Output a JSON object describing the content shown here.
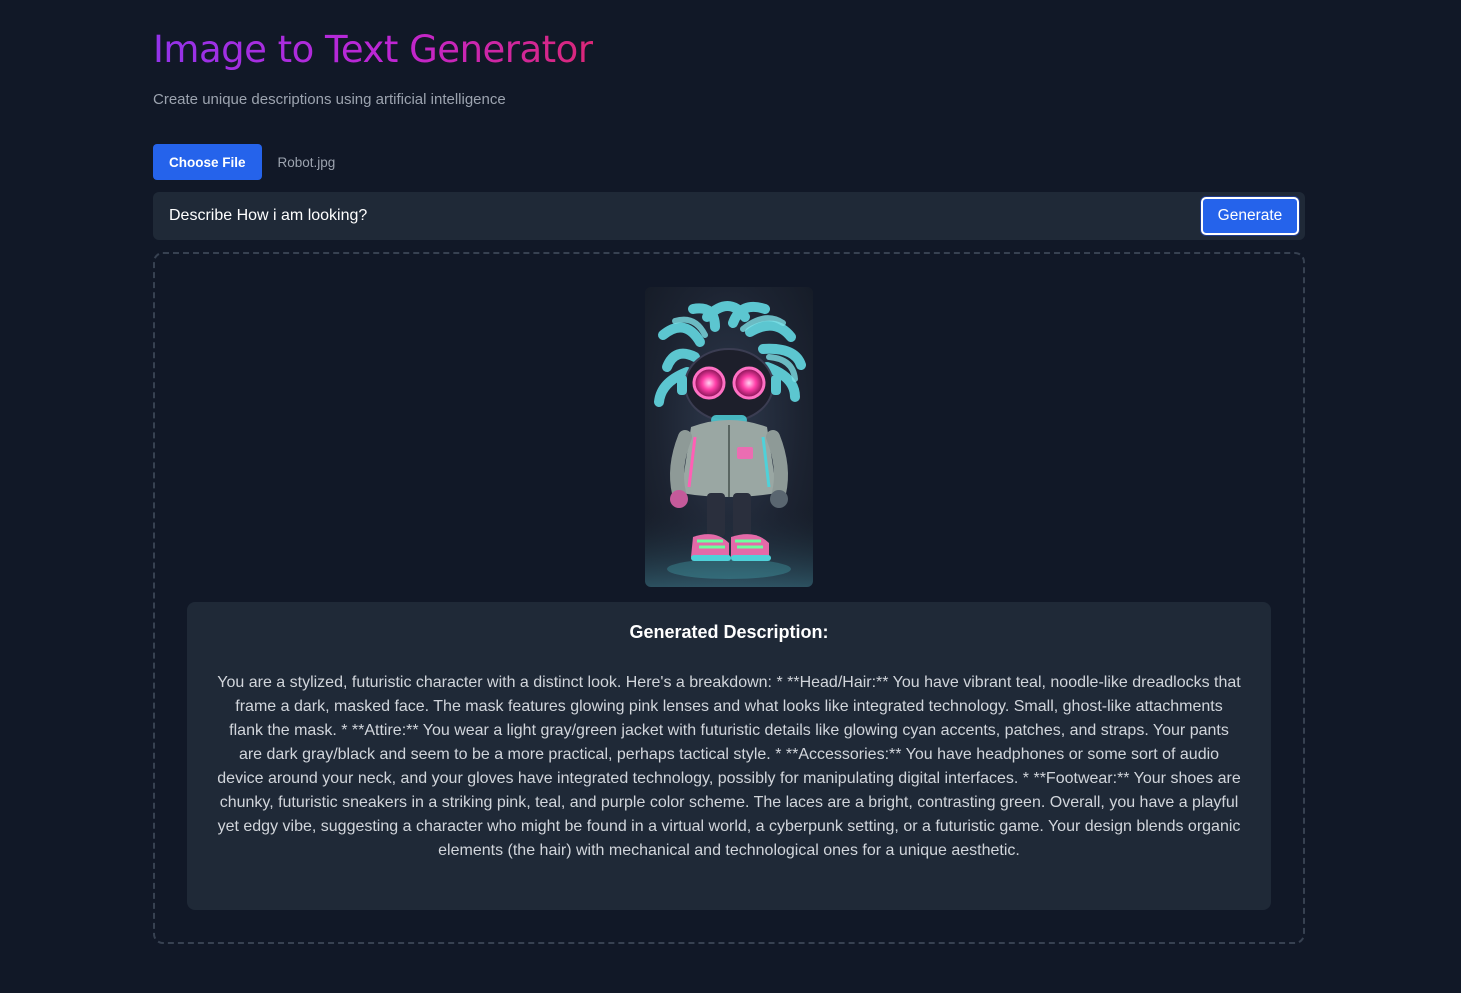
{
  "header": {
    "title": "Image to Text Generator",
    "subtitle": "Create unique descriptions using artificial intelligence"
  },
  "upload": {
    "choose_file_label": "Choose File",
    "file_name": "Robot.jpg"
  },
  "prompt": {
    "value": "Describe How i am looking?",
    "generate_label": "Generate"
  },
  "preview": {
    "alt": "Robot.jpg"
  },
  "result": {
    "heading": "Generated Description:",
    "text": "You are a stylized, futuristic character with a distinct look. Here's a breakdown: * **Head/Hair:** You have vibrant teal, noodle-like dreadlocks that frame a dark, masked face. The mask features glowing pink lenses and what looks like integrated technology. Small, ghost-like attachments flank the mask. * **Attire:** You wear a light gray/green jacket with futuristic details like glowing cyan accents, patches, and straps. Your pants are dark gray/black and seem to be a more practical, perhaps tactical style. * **Accessories:** You have headphones or some sort of audio device around your neck, and your gloves have integrated technology, possibly for manipulating digital interfaces. * **Footwear:** Your shoes are chunky, futuristic sneakers in a striking pink, teal, and purple color scheme. The laces are a bright, contrasting green. Overall, you have a playful yet edgy vibe, suggesting a character who might be found in a virtual world, a cyberpunk setting, or a futuristic game. Your design blends organic elements (the hair) with mechanical and technological ones for a unique aesthetic."
  },
  "colors": {
    "background": "#111827",
    "panel": "#1f2937",
    "accent": "#2563eb",
    "title_gradient_start": "#9333ea",
    "title_gradient_end": "#db2777"
  }
}
